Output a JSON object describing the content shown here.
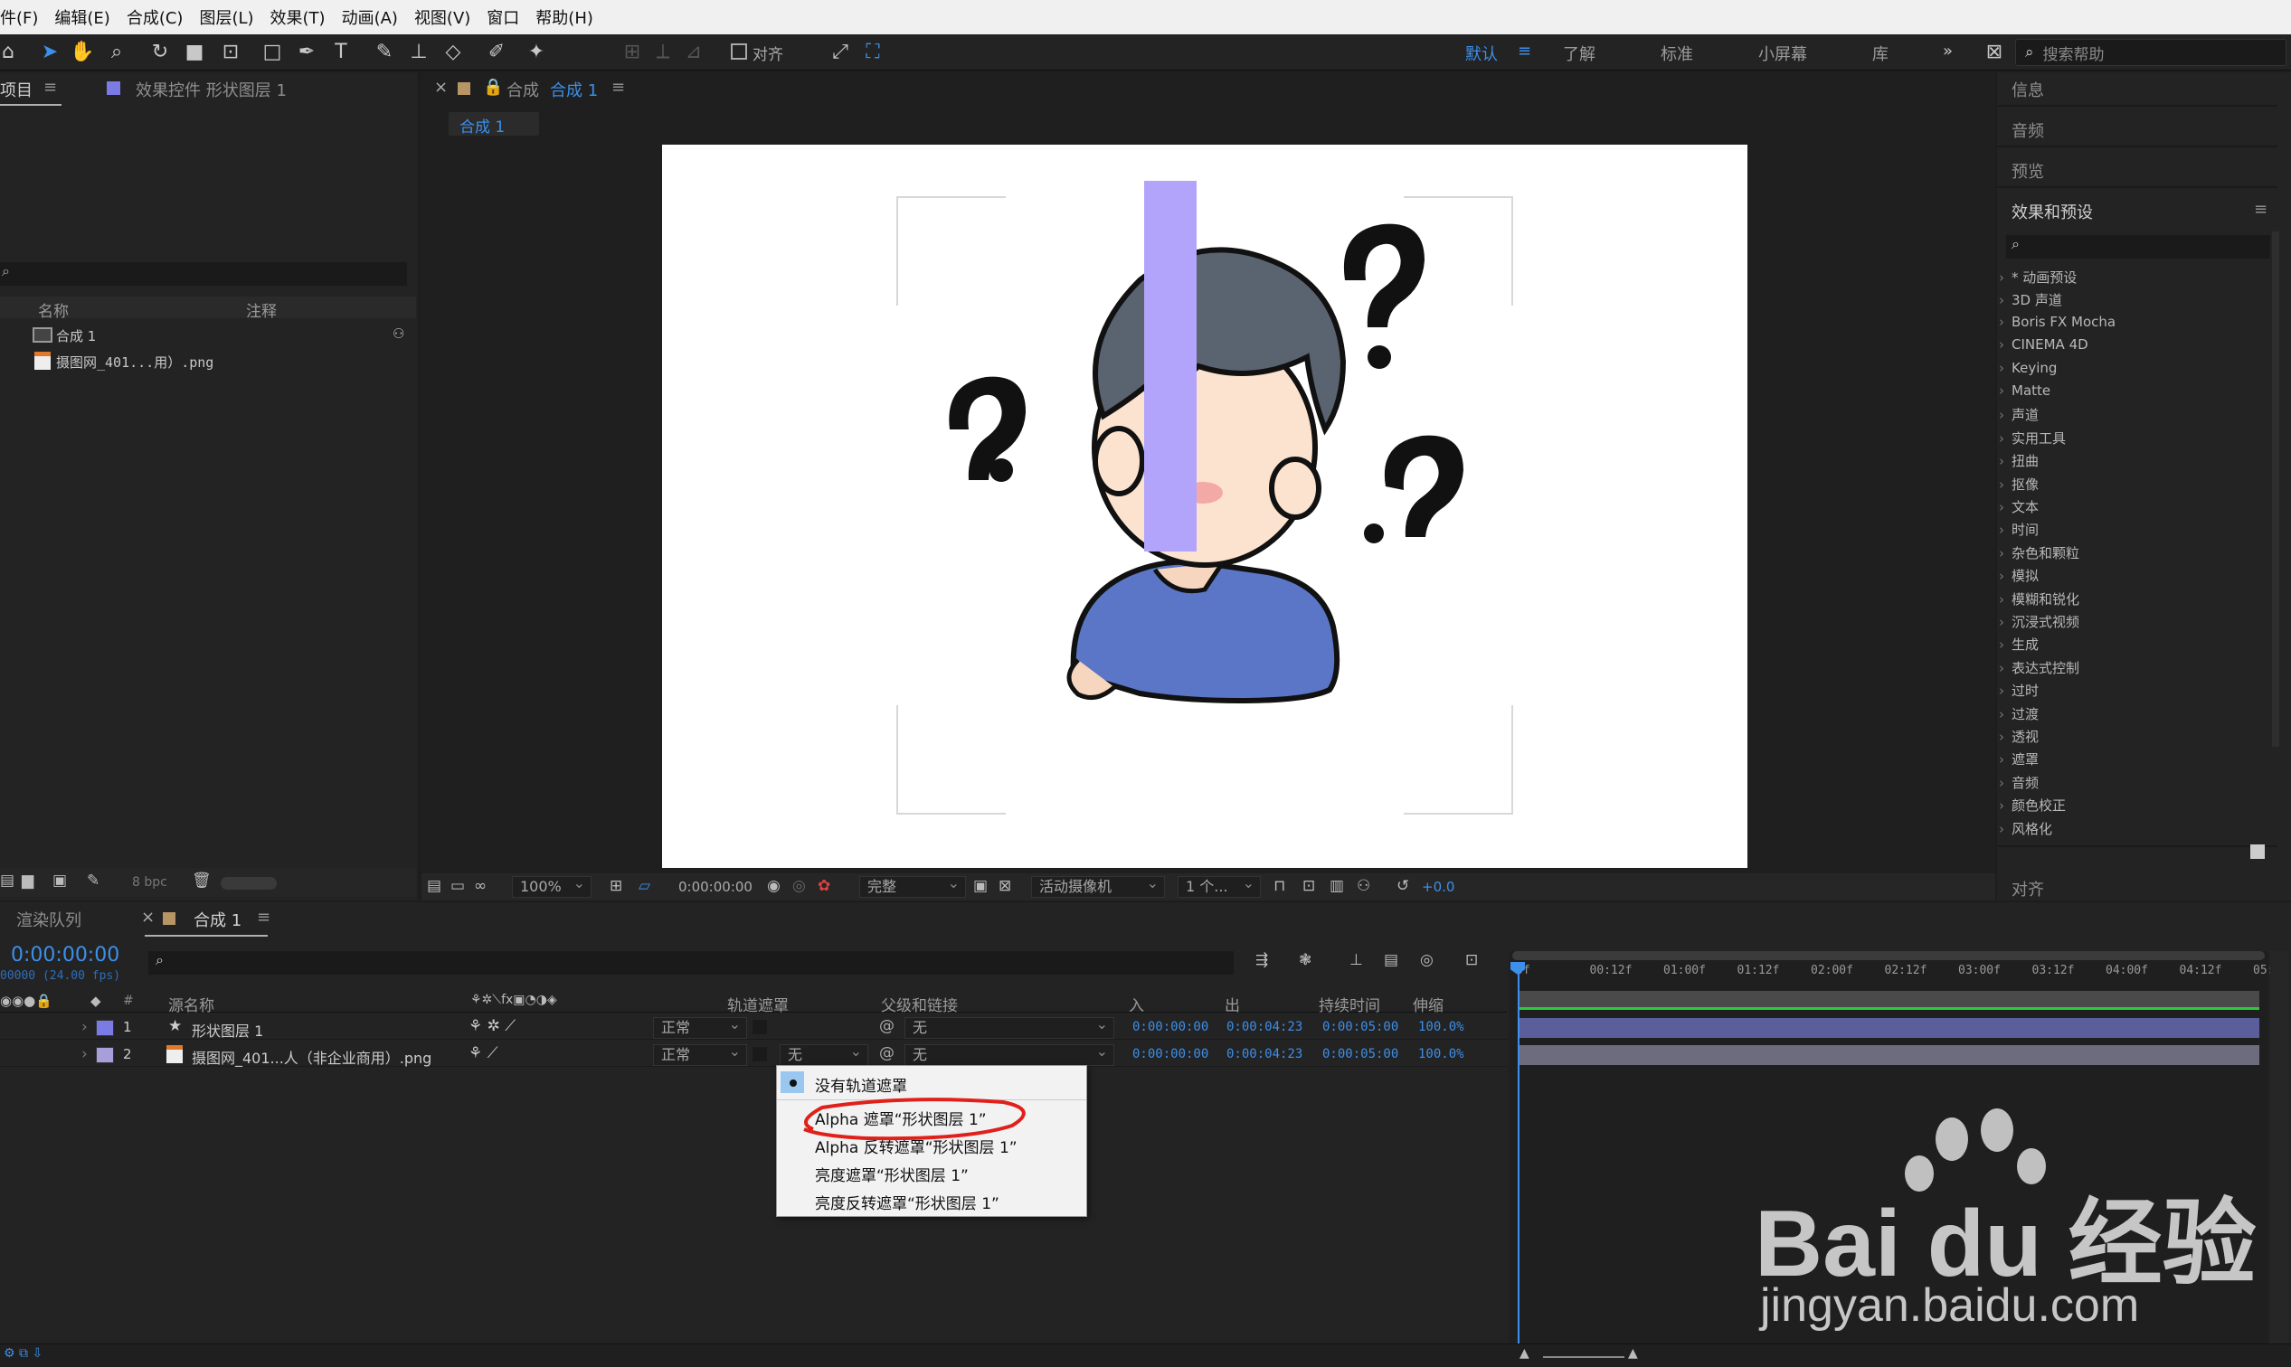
{
  "menubar": {
    "items": [
      "件(F)",
      "编辑(E)",
      "合成(C)",
      "图层(L)",
      "效果(T)",
      "动画(A)",
      "视图(V)",
      "窗口",
      "帮助(H)"
    ]
  },
  "toolbar": {
    "snap_label": "对齐",
    "workspaces": [
      "默认",
      "了解",
      "标准",
      "小屏幕",
      "库"
    ],
    "active_workspace": "默认",
    "search_placeholder": "搜索帮助"
  },
  "project_panel": {
    "tab_label": "项目",
    "effects_tab_label": "效果控件 形状图层 1",
    "col_name": "名称",
    "col_comment": "注释",
    "items": [
      "合成 1",
      "摄图网_401...用）.png"
    ],
    "bpc": "8 bpc"
  },
  "comp_panel": {
    "tab_prefix": "合成",
    "tab_name": "合成 1",
    "breadcrumb": "合成 1",
    "zoom": "100%",
    "timecode": "0:00:00:00",
    "quality": "完整",
    "camera": "活动摄像机",
    "views": "1 个...",
    "exposure": "+0.0"
  },
  "right_panel": {
    "sections": [
      "信息",
      "音频",
      "预览"
    ],
    "effects_title": "效果和预设",
    "effects_list": [
      "* 动画预设",
      "3D 声道",
      "Boris FX Mocha",
      "CINEMA 4D",
      "Keying",
      "Matte",
      "声道",
      "实用工具",
      "扭曲",
      "抠像",
      "文本",
      "时间",
      "杂色和颗粒",
      "模拟",
      "模糊和锐化",
      "沉浸式视频",
      "生成",
      "表达式控制",
      "过时",
      "过渡",
      "透视",
      "遮罩",
      "音频",
      "颜色校正",
      "风格化"
    ],
    "align_title": "对齐"
  },
  "timeline": {
    "render_queue_tab": "渲染队列",
    "comp_tab": "合成 1",
    "current_time": "0:00:00:00",
    "fps_label": "00000 (24.00 fps)",
    "columns": {
      "source": "源名称",
      "track_matte": "轨道遮罩",
      "parent": "父级和链接",
      "in": "入",
      "out": "出",
      "duration": "持续时间",
      "stretch": "伸缩"
    },
    "ruler": [
      "0f",
      "00:12f",
      "01:00f",
      "01:12f",
      "02:00f",
      "02:12f",
      "03:00f",
      "03:12f",
      "04:00f",
      "04:12f",
      "05:0"
    ],
    "layers": [
      {
        "num": "1",
        "name": "形状图层 1",
        "mode": "正常",
        "matte": "",
        "parent": "无",
        "in": "0:00:00:00",
        "out": "0:00:04:23",
        "duration": "0:00:05:00",
        "stretch": "100.0%",
        "label_color": "#7b7be6",
        "bar_color": "#5a5f9c"
      },
      {
        "num": "2",
        "name": "摄图网_401...人（非企业商用）.png",
        "mode": "正常",
        "matte": "无",
        "parent": "无",
        "in": "0:00:00:00",
        "out": "0:00:04:23",
        "duration": "0:00:05:00",
        "stretch": "100.0%",
        "label_color": "#a79fd9",
        "bar_color": "#6c6c7c"
      }
    ]
  },
  "matte_menu": {
    "items": [
      "没有轨道遮罩",
      "Alpha 遮罩“形状图层 1”",
      "Alpha 反转遮罩“形状图层 1”",
      "亮度遮罩“形状图层 1”",
      "亮度反转遮罩“形状图层 1”"
    ],
    "selected_index": 0,
    "highlighted_index": 1,
    "highlight_color": "#e0201a"
  },
  "watermark": {
    "brand": "Bai du 经验",
    "url": "jingyan.baidu.com"
  },
  "canvas": {
    "shape_color": "#b2a4fb",
    "background": "#ffffff"
  }
}
